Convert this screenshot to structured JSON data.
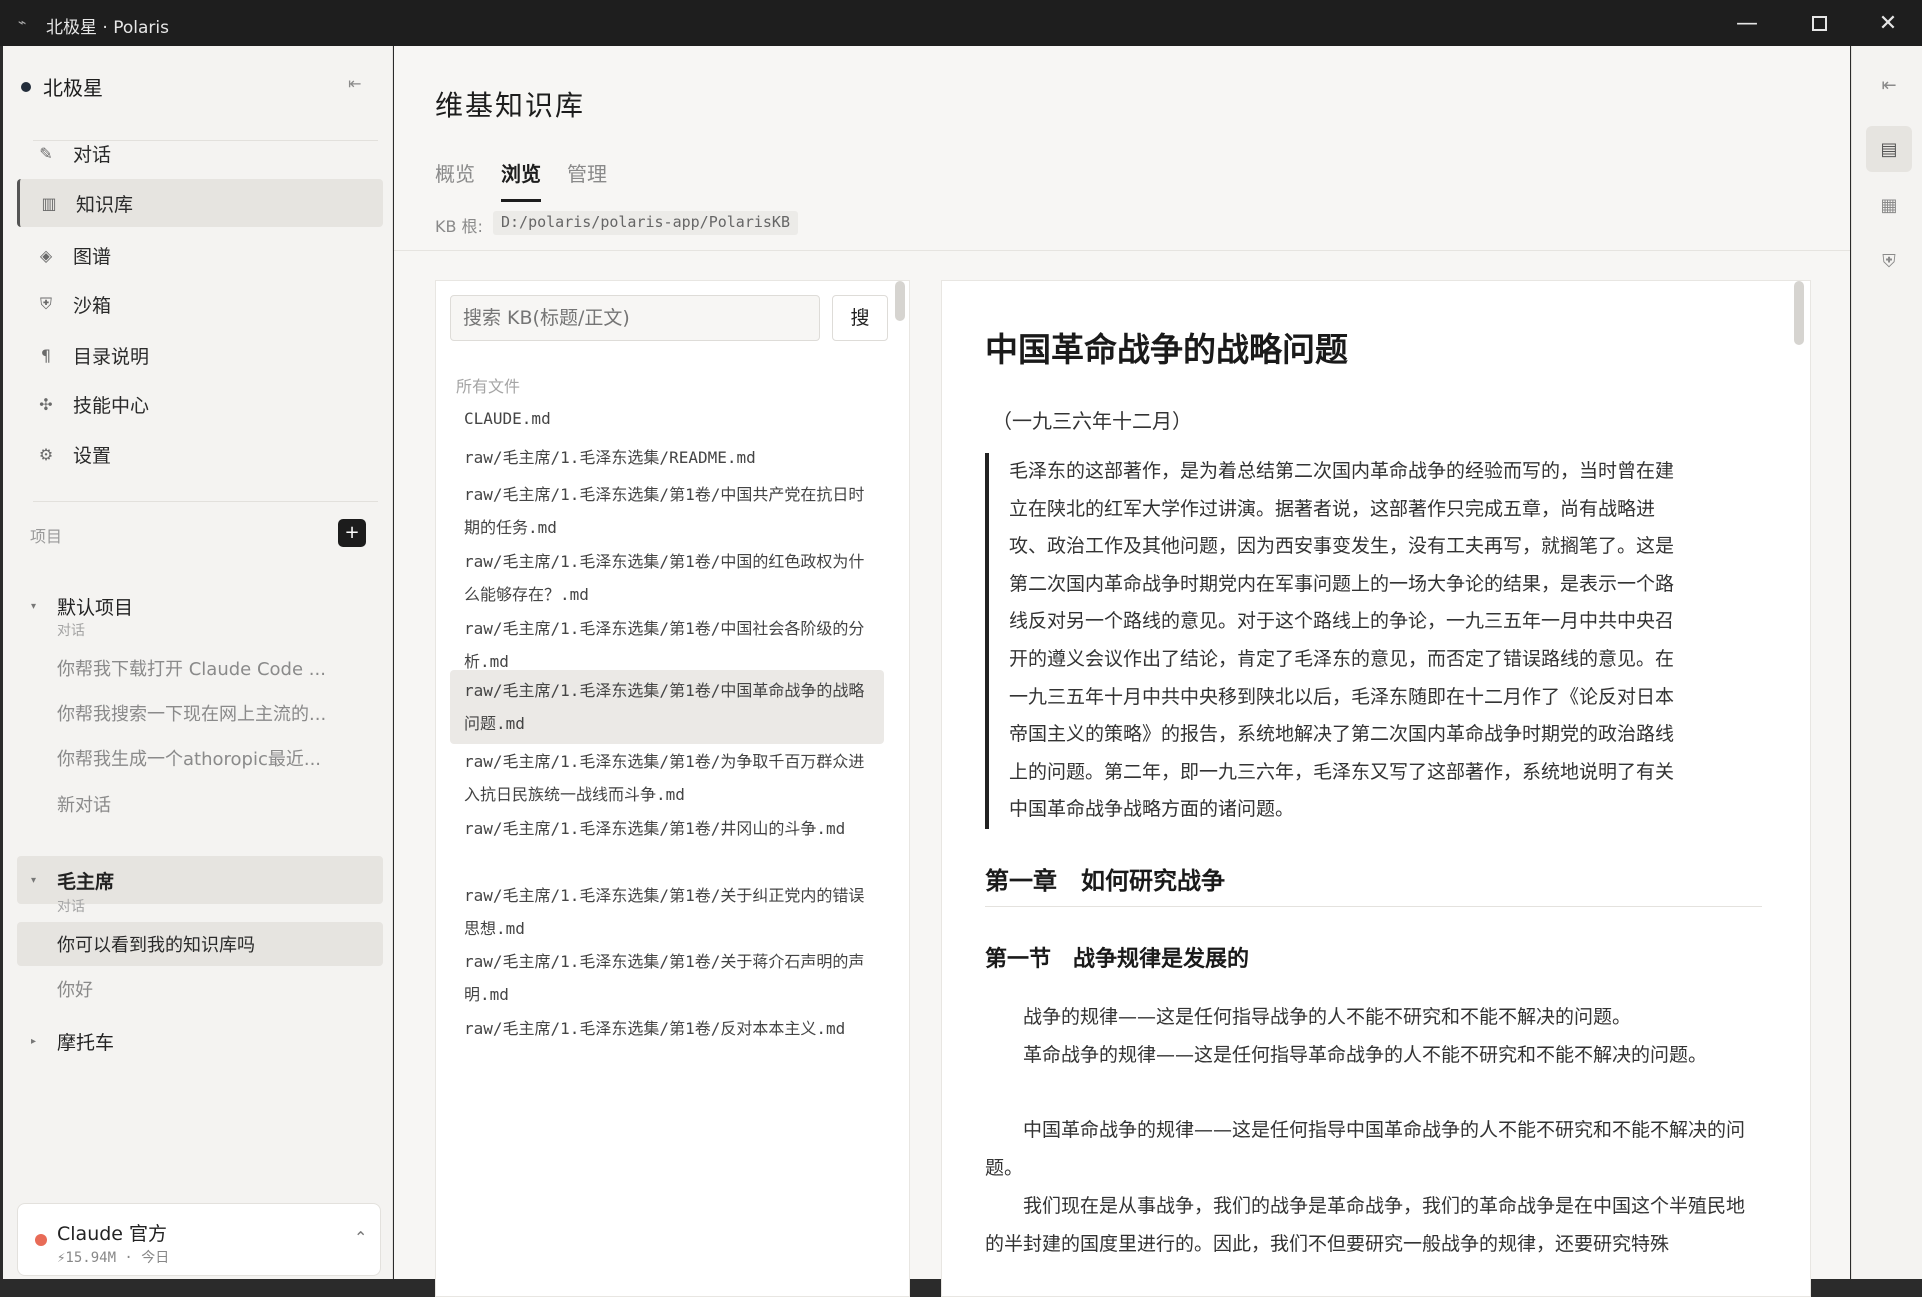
{
  "window": {
    "title": "北极星 · Polaris",
    "app_icon": "link-icon",
    "minimize": "—",
    "close": "✕"
  },
  "sidebar": {
    "brand": "北极星",
    "collapse_icon": "⇤",
    "nav": [
      {
        "label": "对话",
        "icon": "pen-icon",
        "glyph": "✎"
      },
      {
        "label": "知识库",
        "icon": "library-icon",
        "glyph": "▥"
      },
      {
        "label": "图谱",
        "icon": "graph-icon",
        "glyph": "◈"
      },
      {
        "label": "沙箱",
        "icon": "shield-icon",
        "glyph": "⛨"
      },
      {
        "label": "目录说明",
        "icon": "paragraph-icon",
        "glyph": "¶"
      },
      {
        "label": "技能中心",
        "icon": "puzzle-icon",
        "glyph": "✣"
      },
      {
        "label": "设置",
        "icon": "gear-icon",
        "glyph": "⚙"
      }
    ],
    "projects_label": "项目",
    "add_label": "+",
    "projects": [
      {
        "name": "默认项目",
        "caret": "▾",
        "sub_label": "对话",
        "conversations": [
          "你帮我下载打开 Claude Code ...",
          "你帮我搜索一下现在网上主流的...",
          "你帮我生成一个athoropic最近...",
          "新对话"
        ]
      },
      {
        "name": "毛主席",
        "caret": "▾",
        "sub_label": "对话",
        "conversations": [
          "你可以看到我的知识库吗",
          "你好"
        ]
      },
      {
        "name": "摩托车",
        "caret": "▸"
      }
    ],
    "model": {
      "name": "Claude 官方",
      "meta": "⚡15.94M · 今日",
      "chevron": "⌃"
    }
  },
  "main": {
    "title": "维基知识库",
    "tabs": [
      "概览",
      "浏览",
      "管理"
    ],
    "active_tab": 1,
    "kb_label": "KB 根:",
    "kb_path": "D:/polaris/polaris-app/PolarisKB",
    "search_placeholder": "搜索 KB(标题/正文)",
    "search_button": "搜",
    "files_label": "所有文件",
    "files": [
      "CLAUDE.md",
      "raw/毛主席/1.毛泽东选集/README.md",
      "raw/毛主席/1.毛泽东选集/第1卷/中国共产党在抗日时期的任务.md",
      "raw/毛主席/1.毛泽东选集/第1卷/中国的红色政权为什么能够存在？.md",
      "raw/毛主席/1.毛泽东选集/第1卷/中国社会各阶级的分析.md",
      "raw/毛主席/1.毛泽东选集/第1卷/中国革命战争的战略问题.md",
      "raw/毛主席/1.毛泽东选集/第1卷/为争取千百万群众进入抗日民族统一战线而斗争.md",
      "raw/毛主席/1.毛泽东选集/第1卷/井冈山的斗争.md",
      "raw/毛主席/1.毛泽东选集/第1卷/关于纠正党内的错误思想.md",
      "raw/毛主席/1.毛泽东选集/第1卷/关于蒋介石声明的声明.md",
      "raw/毛主席/1.毛泽东选集/第1卷/反对本本主义.md"
    ],
    "active_file": 5
  },
  "doc": {
    "title": "中国革命战争的战略问题",
    "date": "（一九三六年十二月）",
    "quote": "毛泽东的这部著作，是为着总结第二次国内革命战争的经验而写的，当时曾在建立在陕北的红军大学作过讲演。据著者说，这部著作只完成五章，尚有战略进攻、政治工作及其他问题，因为西安事变发生，没有工夫再写，就搁笔了。这是第二次国内革命战争时期党内在军事问题上的一场大争论的结果，是表示一个路线反对另一个路线的意见。对于这个路线上的争论，一九三五年一月中共中央召开的遵义会议作出了结论，肯定了毛泽东的意见，而否定了错误路线的意见。在一九三五年十月中共中央移到陕北以后，毛泽东随即在十二月作了《论反对日本帝国主义的策略》的报告，系统地解决了第二次国内革命战争时期党的政治路线上的问题。第二年，即一九三六年，毛泽东又写了这部著作，系统地说明了有关中国革命战争战略方面的诸问题。",
    "chapter": "第一章　如何研究战争",
    "section": "第一节　战争规律是发展的",
    "paragraphs": [
      "战争的规律——这是任何指导战争的人不能不研究和不能不解决的问题。",
      "革命战争的规律——这是任何指导革命战争的人不能不研究和不能不解决的问题。",
      "中国革命战争的规律——这是任何指导中国革命战争的人不能不研究和不能不解决的问题。",
      "我们现在是从事战争，我们的战争是革命战争，我们的革命战争是在中国这个半殖民地的半封建的国度里进行的。因此，我们不但要研究一般战争的规律，还要研究特殊"
    ]
  },
  "right_rail": {
    "collapse_icon": "⇤",
    "buttons": [
      {
        "icon": "document-icon",
        "glyph": "▤"
      },
      {
        "icon": "grid-icon",
        "glyph": "▦"
      },
      {
        "icon": "shield-plus-icon",
        "glyph": "⛨"
      }
    ]
  }
}
